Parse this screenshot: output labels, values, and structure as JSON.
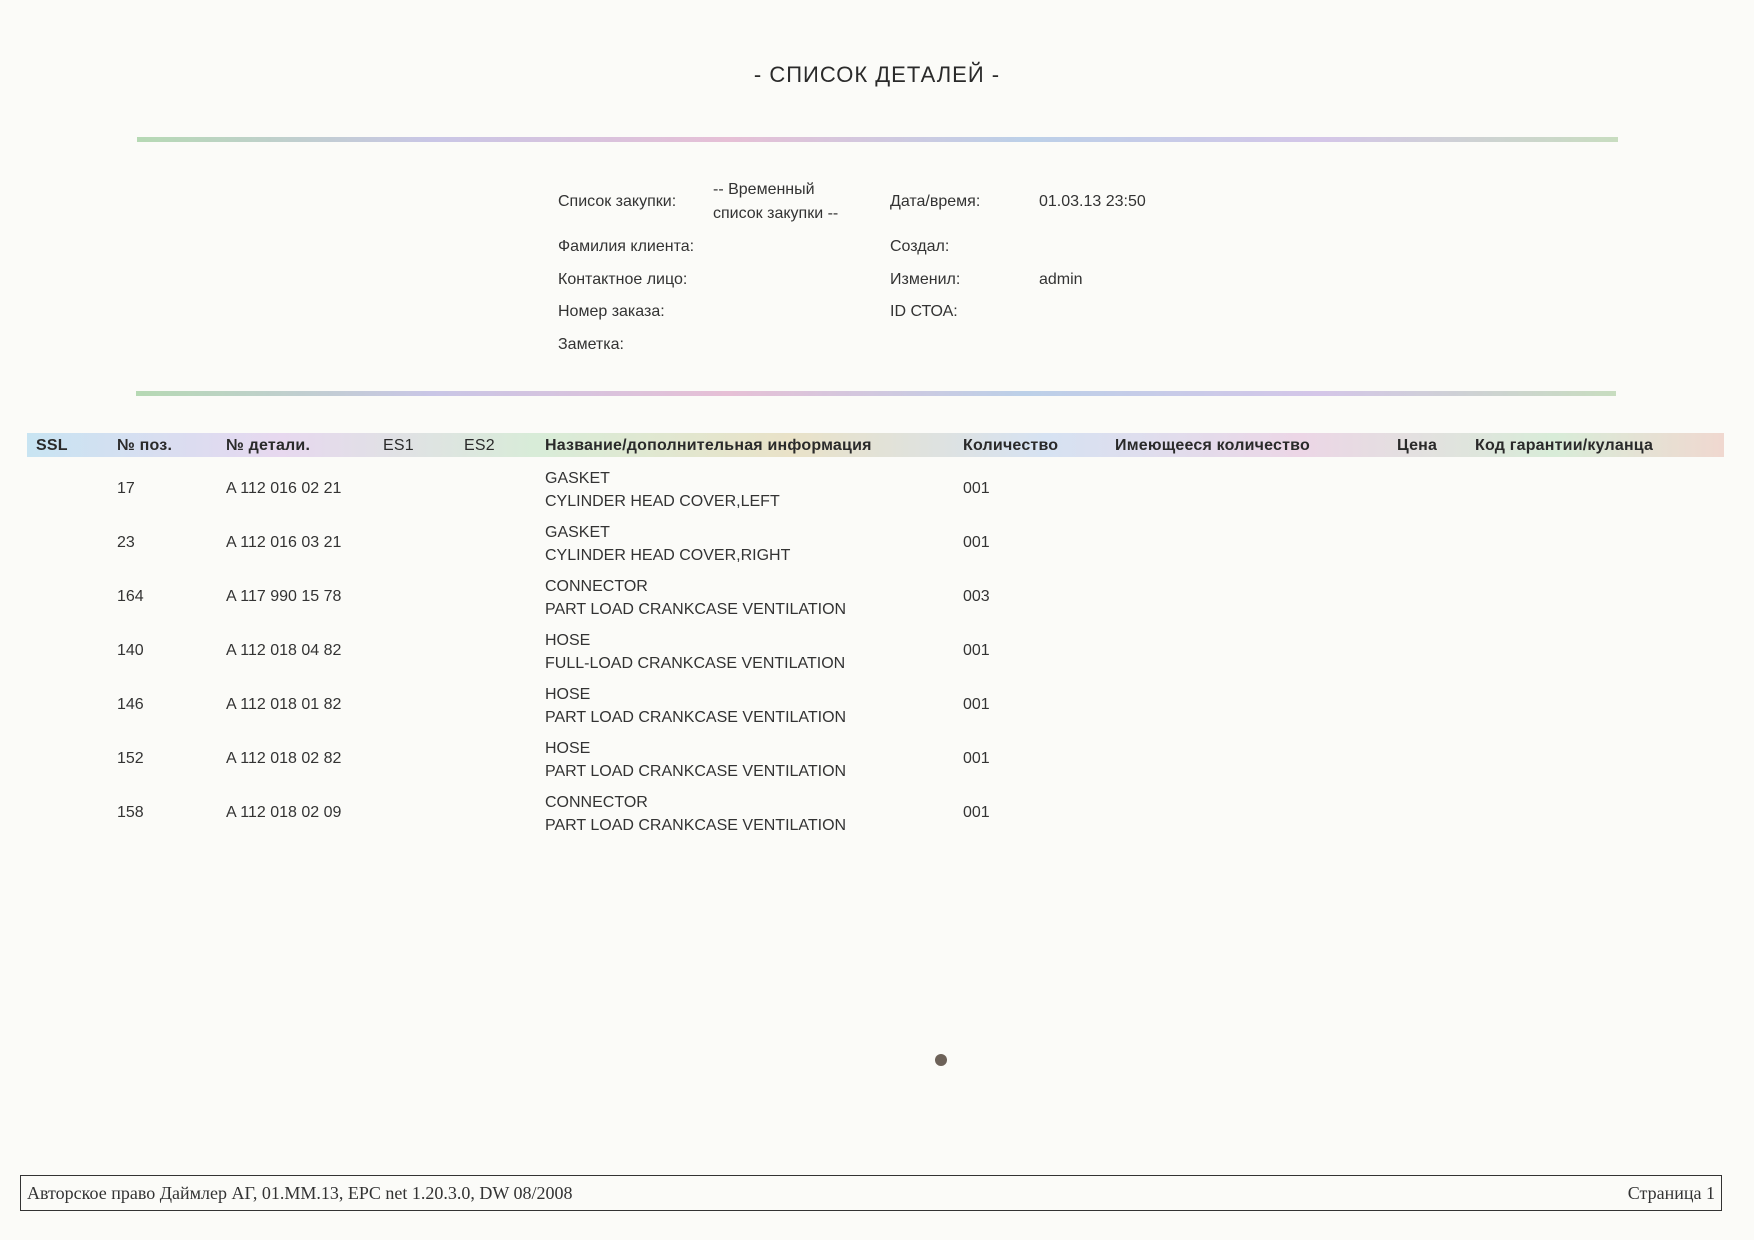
{
  "title": "- СПИСОК ДЕТАЛЕЙ -",
  "info": {
    "purchase_list_label": "Список закупки:",
    "purchase_list_value_line1": "-- Временный",
    "purchase_list_value_line2": "список закупки --",
    "datetime_label": "Дата/время:",
    "datetime_value": "01.03.13 23:50",
    "client_label": "Фамилия клиента:",
    "created_label": "Создал:",
    "contact_label": "Контактное лицо:",
    "modified_label": "Изменил:",
    "modified_value": "admin",
    "order_label": "Номер заказа:",
    "sto_label": "ID СТОА:",
    "note_label": "Заметка:"
  },
  "table": {
    "headers": {
      "ssl": "SSL",
      "pos": "№ поз.",
      "part": "№ детали.",
      "es1": "ES1",
      "es2": "ES2",
      "name": "Название/дополнительная информация",
      "qty": "Количество",
      "avail": "Имеющееся количество",
      "price": "Цена",
      "code": "Код гарантии/куланца"
    },
    "rows": [
      {
        "pos": "17",
        "part": "A 112 016 02 21",
        "name": "GASKET",
        "info": "CYLINDER HEAD COVER,LEFT",
        "qty": "001"
      },
      {
        "pos": "23",
        "part": "A 112 016 03 21",
        "name": "GASKET",
        "info": "CYLINDER HEAD COVER,RIGHT",
        "qty": "001"
      },
      {
        "pos": "164",
        "part": "A 117 990 15 78",
        "name": "CONNECTOR",
        "info": "PART LOAD CRANKCASE VENTILATION",
        "qty": "003"
      },
      {
        "pos": "140",
        "part": "A 112 018 04 82",
        "name": "HOSE",
        "info": "FULL-LOAD CRANKCASE VENTILATION",
        "qty": "001"
      },
      {
        "pos": "146",
        "part": "A 112 018 01 82",
        "name": "HOSE",
        "info": "PART LOAD CRANKCASE VENTILATION",
        "qty": "001"
      },
      {
        "pos": "152",
        "part": "A 112 018 02 82",
        "name": "HOSE",
        "info": "PART LOAD CRANKCASE VENTILATION",
        "qty": "001"
      },
      {
        "pos": "158",
        "part": "A 112 018 02 09",
        "name": "CONNECTOR",
        "info": "PART LOAD CRANKCASE VENTILATION",
        "qty": "001"
      }
    ]
  },
  "footer": {
    "copyright": "Авторское право Даймлер АГ, 01.ММ.13, EPC net 1.20.3.0, DW 08/2008",
    "page": "Страница 1"
  }
}
